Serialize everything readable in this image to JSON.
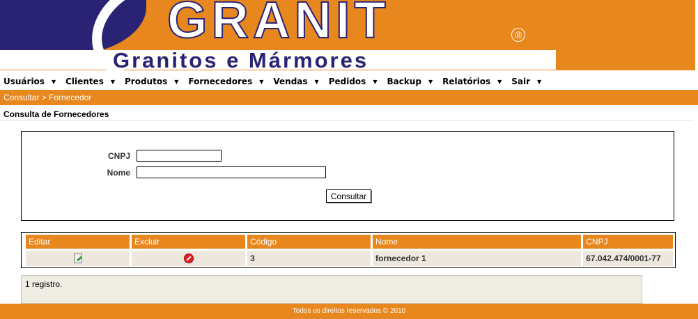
{
  "brand": {
    "name": "GRANIT",
    "registered_mark": "®",
    "tagline": "Granitos e Mármores"
  },
  "menu": [
    {
      "label": "Usuários"
    },
    {
      "label": "Clientes"
    },
    {
      "label": "Produtos"
    },
    {
      "label": "Fornecedores"
    },
    {
      "label": "Vendas"
    },
    {
      "label": "Pedidos"
    },
    {
      "label": "Backup"
    },
    {
      "label": "Relatórios"
    },
    {
      "label": "Sair"
    }
  ],
  "breadcrumb": "Consultar > Fornecedor",
  "section_title": "Consulta de Fornecedores",
  "form": {
    "cnpj_label": "CNPJ",
    "cnpj_value": "",
    "nome_label": "Nome",
    "nome_value": "",
    "submit_label": "Consultar"
  },
  "table": {
    "headers": [
      "Editar",
      "Excluir",
      "Código",
      "Nome",
      "CNPJ"
    ],
    "rows": [
      {
        "codigo": "3",
        "nome": "fornecedor 1",
        "cnpj": "67.042.474/0001-77"
      }
    ]
  },
  "record_count": "1 registro.",
  "footer": "Todos os direitos reservados © 2010",
  "colors": {
    "accent": "#e8871e",
    "navy": "#2a2375",
    "row_bg": "#ede7de"
  }
}
